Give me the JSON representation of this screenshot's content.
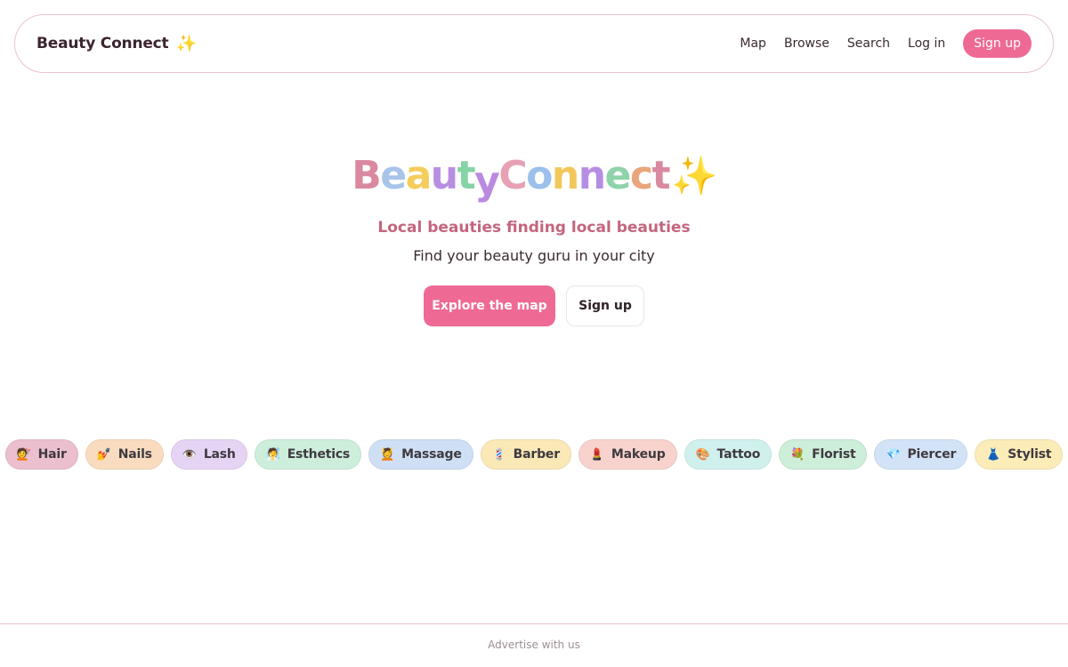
{
  "nav": {
    "brand": "Beauty Connect",
    "brand_icon": "✨",
    "links": [
      "Map",
      "Browse",
      "Search",
      "Log in"
    ],
    "signup": "Sign up"
  },
  "hero": {
    "logo_letters": [
      {
        "ch": "B",
        "color": "#d98aa0"
      },
      {
        "ch": "e",
        "color": "#a9c4ea"
      },
      {
        "ch": "a",
        "color": "#f5cd5c"
      },
      {
        "ch": "u",
        "color": "#b88ee3"
      },
      {
        "ch": "t",
        "color": "#86d3a6"
      },
      {
        "ch": "y",
        "color": "#b98ae0"
      },
      {
        "ch": "C",
        "color": "#e7a0b4"
      },
      {
        "ch": "o",
        "color": "#9bc0ea"
      },
      {
        "ch": "n",
        "color": "#f2c75a"
      },
      {
        "ch": "n",
        "color": "#b58ee3"
      },
      {
        "ch": "e",
        "color": "#8fd3a8"
      },
      {
        "ch": "c",
        "color": "#e9a57b"
      },
      {
        "ch": "t",
        "color": "#d98aa0"
      }
    ],
    "logo_icon": "✨",
    "tagline": "Local beauties finding local beauties",
    "subtitle": "Find your beauty guru in your city",
    "primary_button": "Explore the map",
    "secondary_button": "Sign up"
  },
  "categories": [
    {
      "emoji": "💇",
      "label": "Hair",
      "bg": "#ebbfce"
    },
    {
      "emoji": "💅",
      "label": "Nails",
      "bg": "#f9dcc0"
    },
    {
      "emoji": "👁️",
      "label": "Lash",
      "bg": "#e6d4f4"
    },
    {
      "emoji": "🧖",
      "label": "Esthetics",
      "bg": "#cdeedb"
    },
    {
      "emoji": "💆",
      "label": "Massage",
      "bg": "#cfdff5"
    },
    {
      "emoji": "💈",
      "label": "Barber",
      "bg": "#fae8b6"
    },
    {
      "emoji": "💄",
      "label": "Makeup",
      "bg": "#f8d3cd"
    },
    {
      "emoji": "🎨",
      "label": "Tattoo",
      "bg": "#d0f0ee"
    },
    {
      "emoji": "💐",
      "label": "Florist",
      "bg": "#cdeed9"
    },
    {
      "emoji": "💎",
      "label": "Piercer",
      "bg": "#d3e3f7"
    },
    {
      "emoji": "👗",
      "label": "Stylist",
      "bg": "#fbecb8"
    }
  ],
  "footer": {
    "link": "Advertise with us"
  }
}
